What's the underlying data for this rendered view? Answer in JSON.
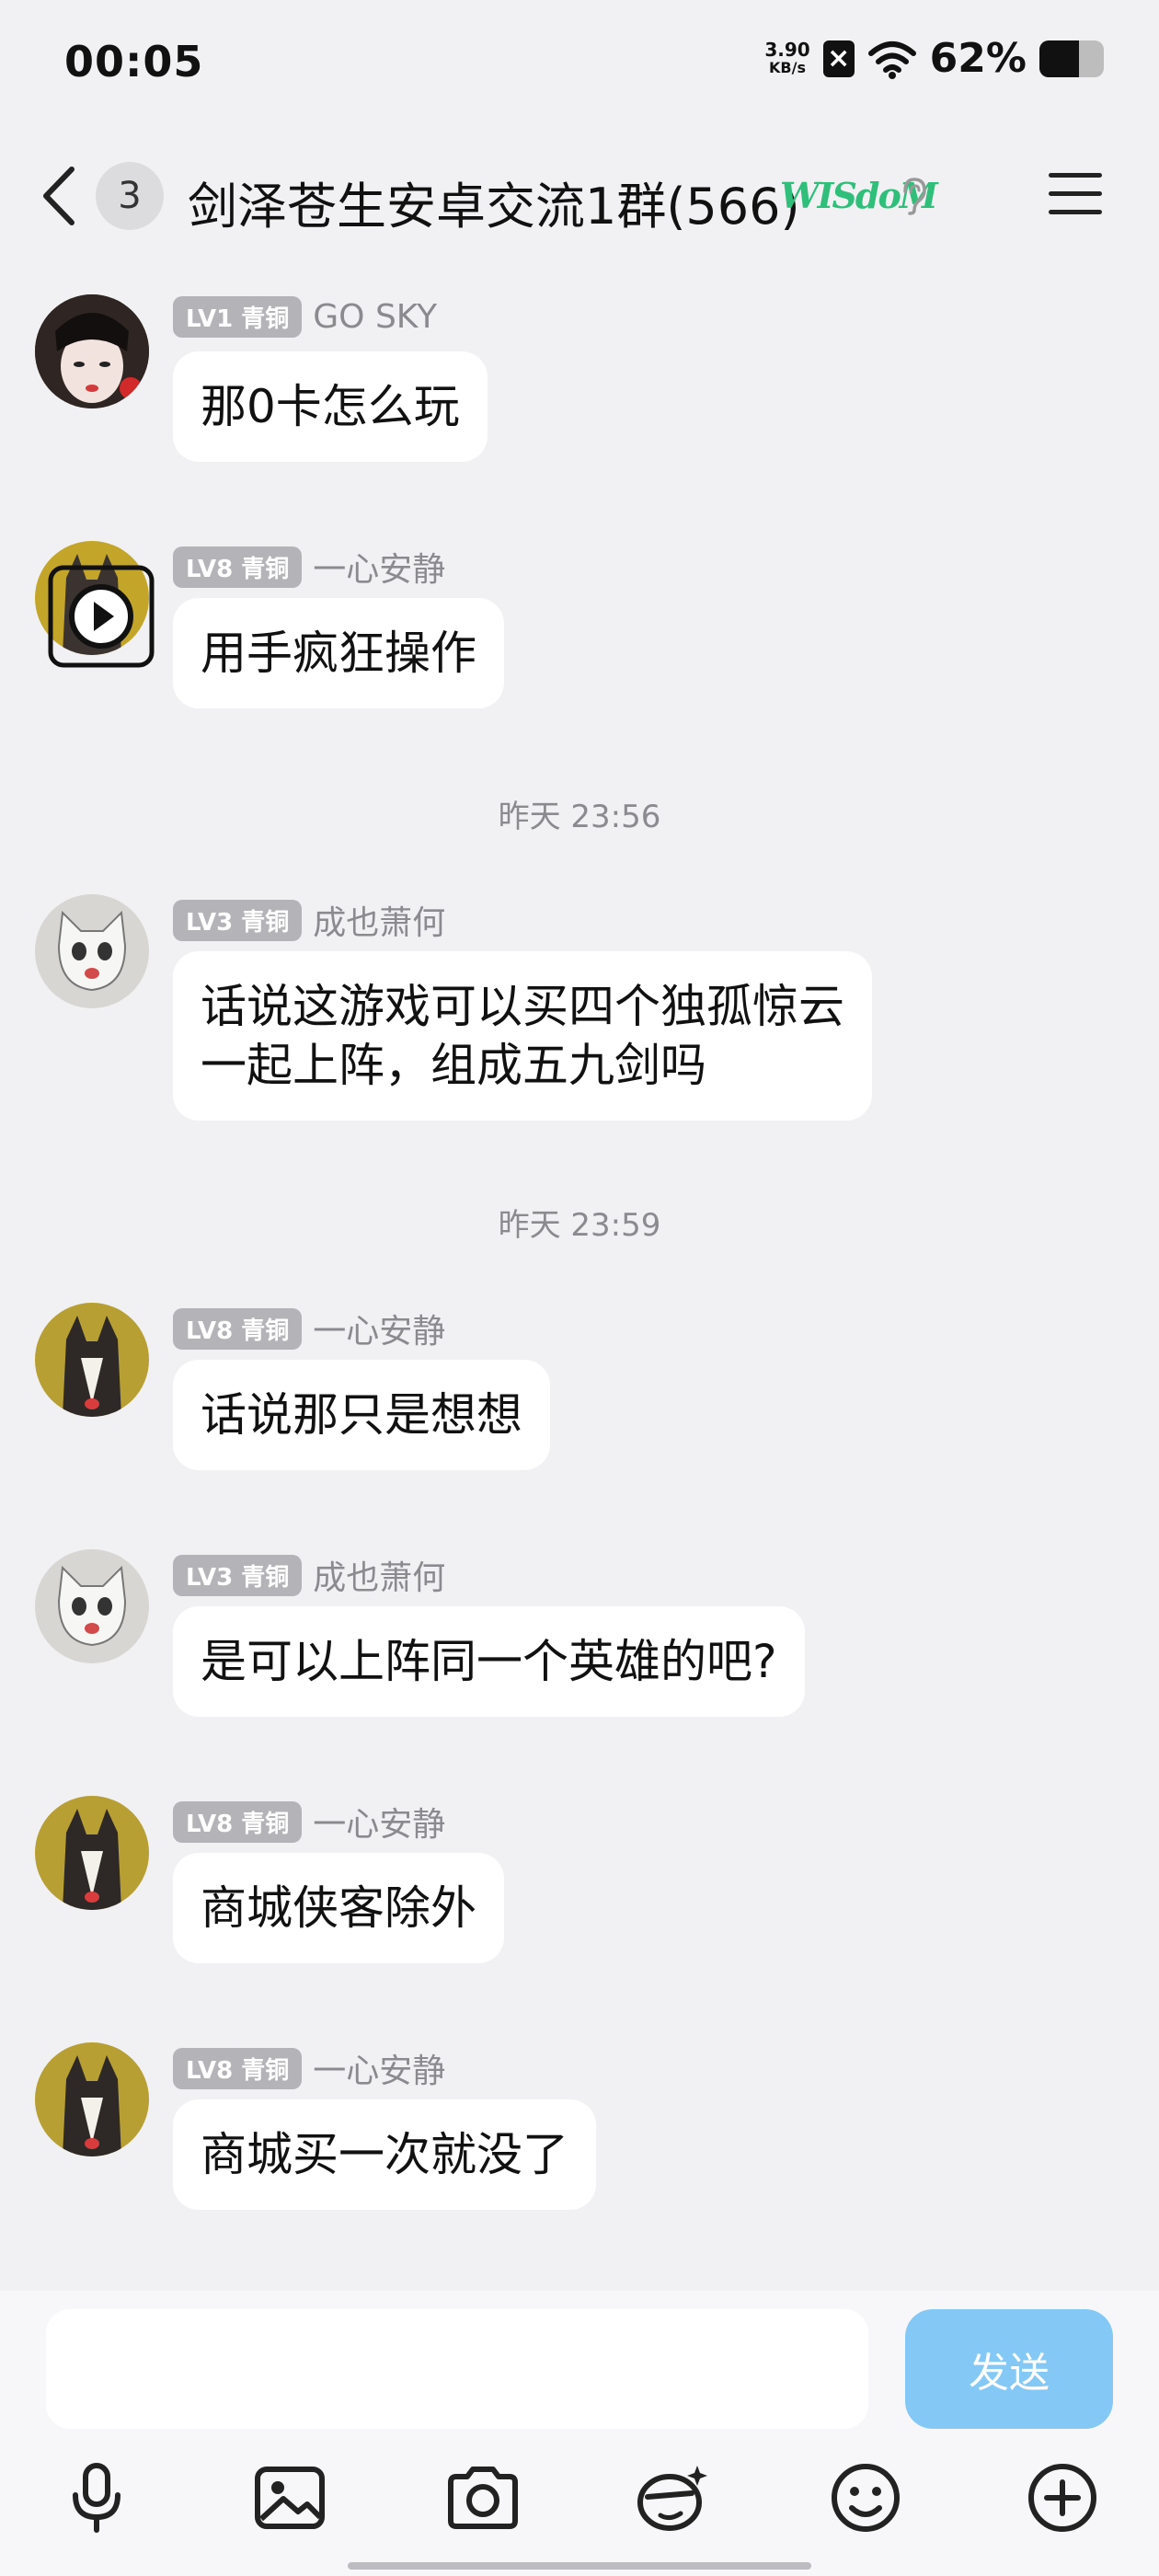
{
  "status_bar": {
    "time": "00:05",
    "net_speed_value": "3.90",
    "net_speed_unit": "KB/s",
    "battery_text": "62%",
    "battery_level": 0.62
  },
  "header": {
    "unread_count": "3",
    "group_title": "剑泽苍生安卓交流1群(566)",
    "badge_text": "WISdoM"
  },
  "messages": [
    {
      "level": "LV1 青铜",
      "name": "GO SKY",
      "text": "那0卡怎么玩"
    },
    {
      "level": "LV8 青铜",
      "name": "一心安静",
      "text": "用手疯狂操作"
    },
    {
      "level": "LV3 青铜",
      "name": "成也萧何",
      "text_line1": "话说这游戏可以买四个独孤惊云",
      "text_line2": "一起上阵，组成五九剑吗"
    },
    {
      "level": "LV8 青铜",
      "name": "一心安静",
      "text": "话说那只是想想"
    },
    {
      "level": "LV3 青铜",
      "name": "成也萧何",
      "text": "是可以上阵同一个英雄的吧?"
    },
    {
      "level": "LV8 青铜",
      "name": "一心安静",
      "text": "商城侠客除外"
    },
    {
      "level": "LV8 青铜",
      "name": "一心安静",
      "text": "商城买一次就没了"
    }
  ],
  "timestamps": [
    "昨天 23:56",
    "昨天 23:59"
  ],
  "input": {
    "send_label": "发送",
    "toolbar_icons": [
      "microphone-icon",
      "image-icon",
      "camera-icon",
      "sticker-icon",
      "emoji-icon",
      "plus-icon"
    ]
  },
  "colors": {
    "background": "#f1f1f4",
    "bubble": "#ffffff",
    "level_badge": "#b3b3b8",
    "send_button": "#84c9f5",
    "badge_green": "#2fbf7a"
  }
}
